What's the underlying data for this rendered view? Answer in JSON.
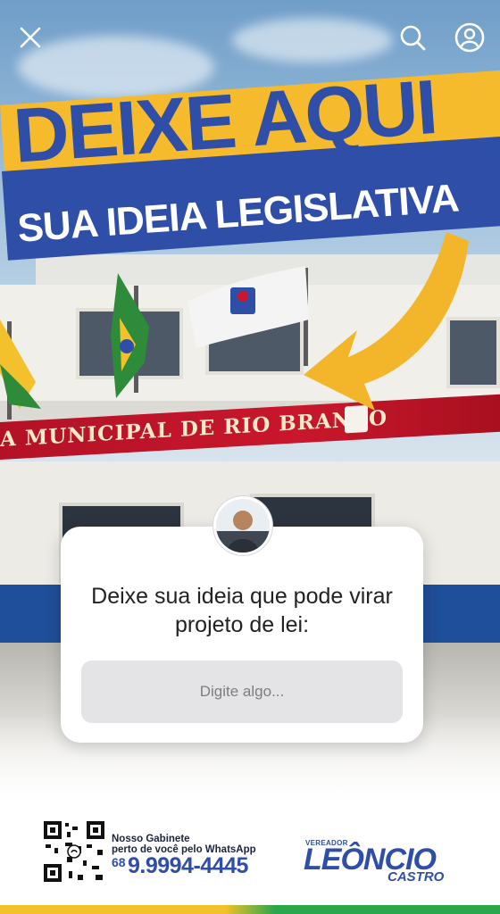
{
  "controls": {
    "close_icon": "close-icon",
    "search_icon": "search-icon",
    "profile_icon": "user-circle-icon"
  },
  "banner": {
    "line1": "DEIXE AQUI",
    "line2": "SUA IDEIA LEGISLATIVA",
    "colors": {
      "yellow": "#f6bb2c",
      "blue": "#2f4ea8"
    }
  },
  "building": {
    "sign_text": "A MUNICIPAL DE RIO BRANCO"
  },
  "question_sticker": {
    "prompt": "Deixe sua ideia que pode virar projeto de lei:",
    "placeholder": "Digite algo..."
  },
  "footer": {
    "line1": "Nosso Gabinete",
    "line2": "perto de você pelo WhatsApp",
    "area_code": "68",
    "phone": "9.9994-4445",
    "logo_small": "VEREADOR",
    "logo_name": "LEÔNCIO",
    "logo_surname": "CASTRO"
  }
}
